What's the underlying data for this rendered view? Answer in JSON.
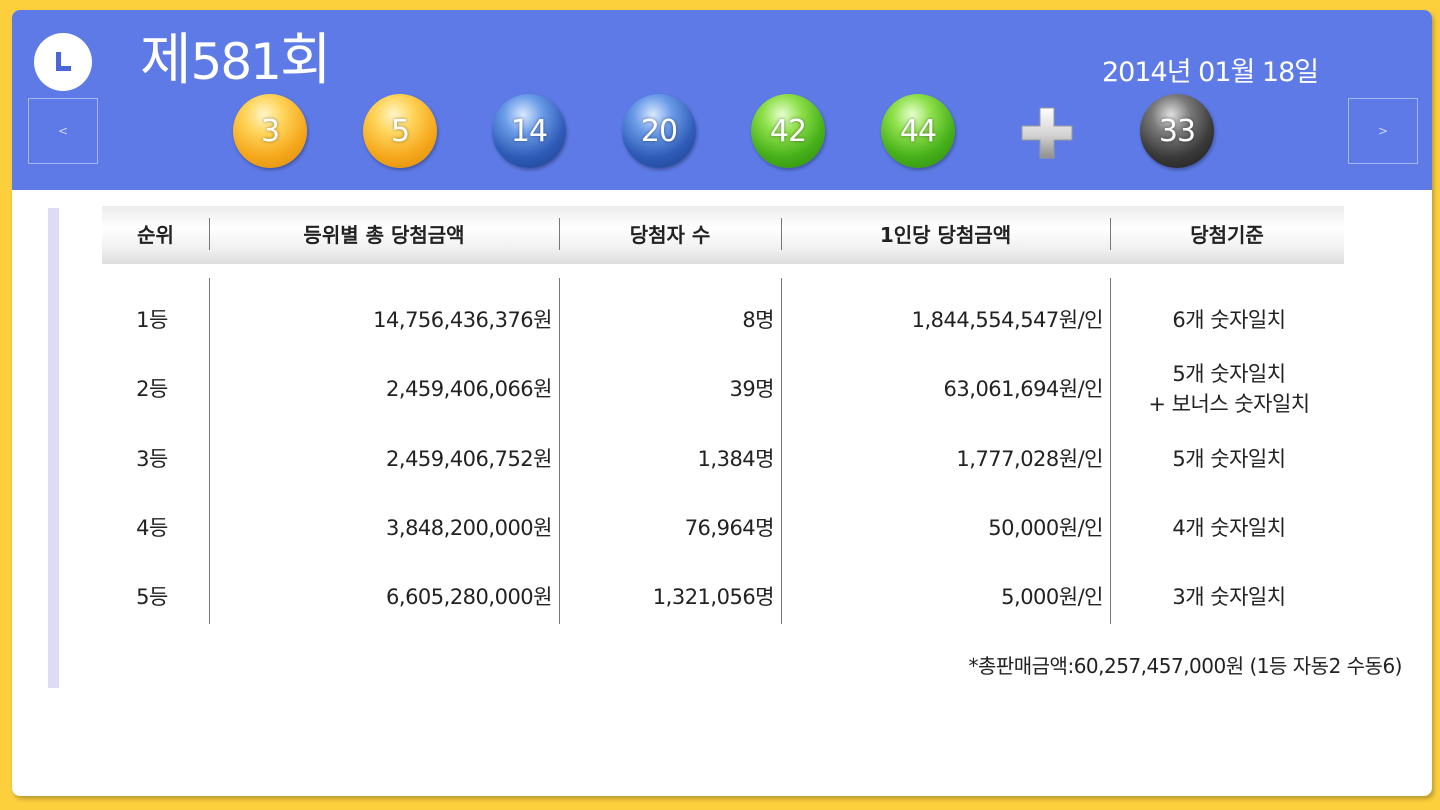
{
  "header": {
    "logo_icon": "lotto-logo-icon",
    "title_prefix": "제",
    "title_number": "581",
    "title_suffix": "회",
    "date": "2014년 01월 18일",
    "prev_label": "<",
    "next_label": ">",
    "background_color": "#5d7ae6"
  },
  "balls": [
    {
      "number": "3",
      "color": "yellow"
    },
    {
      "number": "5",
      "color": "yellow"
    },
    {
      "number": "14",
      "color": "blue"
    },
    {
      "number": "20",
      "color": "blue"
    },
    {
      "number": "42",
      "color": "green"
    },
    {
      "number": "44",
      "color": "green"
    }
  ],
  "bonus_ball": {
    "number": "33",
    "color": "black"
  },
  "plus_icon": "plus-icon",
  "table": {
    "headers": [
      "순위",
      "등위별 총 당첨금액",
      "당첨자 수",
      "1인당 당첨금액",
      "당첨기준"
    ],
    "rows": [
      {
        "rank": "1등",
        "total": "14,756,436,376원",
        "winners": "8명",
        "per_person": "1,844,554,547원/인",
        "criteria": "6개 숫자일치",
        "criteria2": ""
      },
      {
        "rank": "2등",
        "total": "2,459,406,066원",
        "winners": "39명",
        "per_person": "63,061,694원/인",
        "criteria": "5개 숫자일치",
        "criteria2": "+ 보너스 숫자일치"
      },
      {
        "rank": "3등",
        "total": "2,459,406,752원",
        "winners": "1,384명",
        "per_person": "1,777,028원/인",
        "criteria": "5개 숫자일치",
        "criteria2": ""
      },
      {
        "rank": "4등",
        "total": "3,848,200,000원",
        "winners": "76,964명",
        "per_person": "50,000원/인",
        "criteria": "4개 숫자일치",
        "criteria2": ""
      },
      {
        "rank": "5등",
        "total": "6,605,280,000원",
        "winners": "1,321,056명",
        "per_person": "5,000원/인",
        "criteria": "3개 숫자일치",
        "criteria2": ""
      }
    ]
  },
  "footer_note": "*총판매금액:60,257,457,000원 (1등 자동2 수동6)"
}
